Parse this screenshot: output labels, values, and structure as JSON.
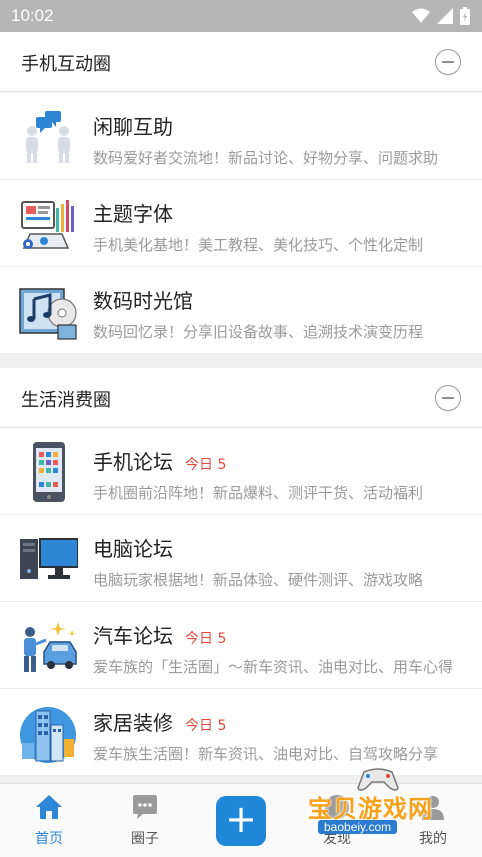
{
  "status_bar": {
    "time": "10:02"
  },
  "sections": [
    {
      "title": "手机互动圈",
      "forums": [
        {
          "name": "闲聊互助",
          "today": "",
          "desc": "数码爱好者交流地！新品讨论、好物分享、问题求助"
        },
        {
          "name": "主题字体",
          "today": "",
          "desc": "手机美化基地！美工教程、美化技巧、个性化定制"
        },
        {
          "name": "数码时光馆",
          "today": "",
          "desc": "数码回忆录！分享旧设备故事、追溯技术演变历程"
        }
      ]
    },
    {
      "title": "生活消费圈",
      "forums": [
        {
          "name": "手机论坛",
          "today": "今日 5",
          "desc": "手机圈前沿阵地！新品爆料、测评干货、活动福利"
        },
        {
          "name": "电脑论坛",
          "today": "",
          "desc": "电脑玩家根据地！新品体验、硬件测评、游戏攻略"
        },
        {
          "name": "汽车论坛",
          "today": "今日 5",
          "desc": "爱车族的「生活圈」〜新车资讯、油电对比、用车心得"
        },
        {
          "name": "家居装修",
          "today": "今日 5",
          "desc": "爱车族生活圈！新车资讯、油电对比、自驾攻略分享"
        }
      ]
    }
  ],
  "bottom_nav": {
    "home": "首页",
    "circle": "圈子",
    "plus": "+",
    "discover": "发现",
    "mine": "我的"
  },
  "watermark": {
    "text": "宝贝游戏网",
    "url": "baobeiy.com"
  },
  "colors": {
    "accent": "#1f88d9",
    "today": "#e24b3b"
  }
}
